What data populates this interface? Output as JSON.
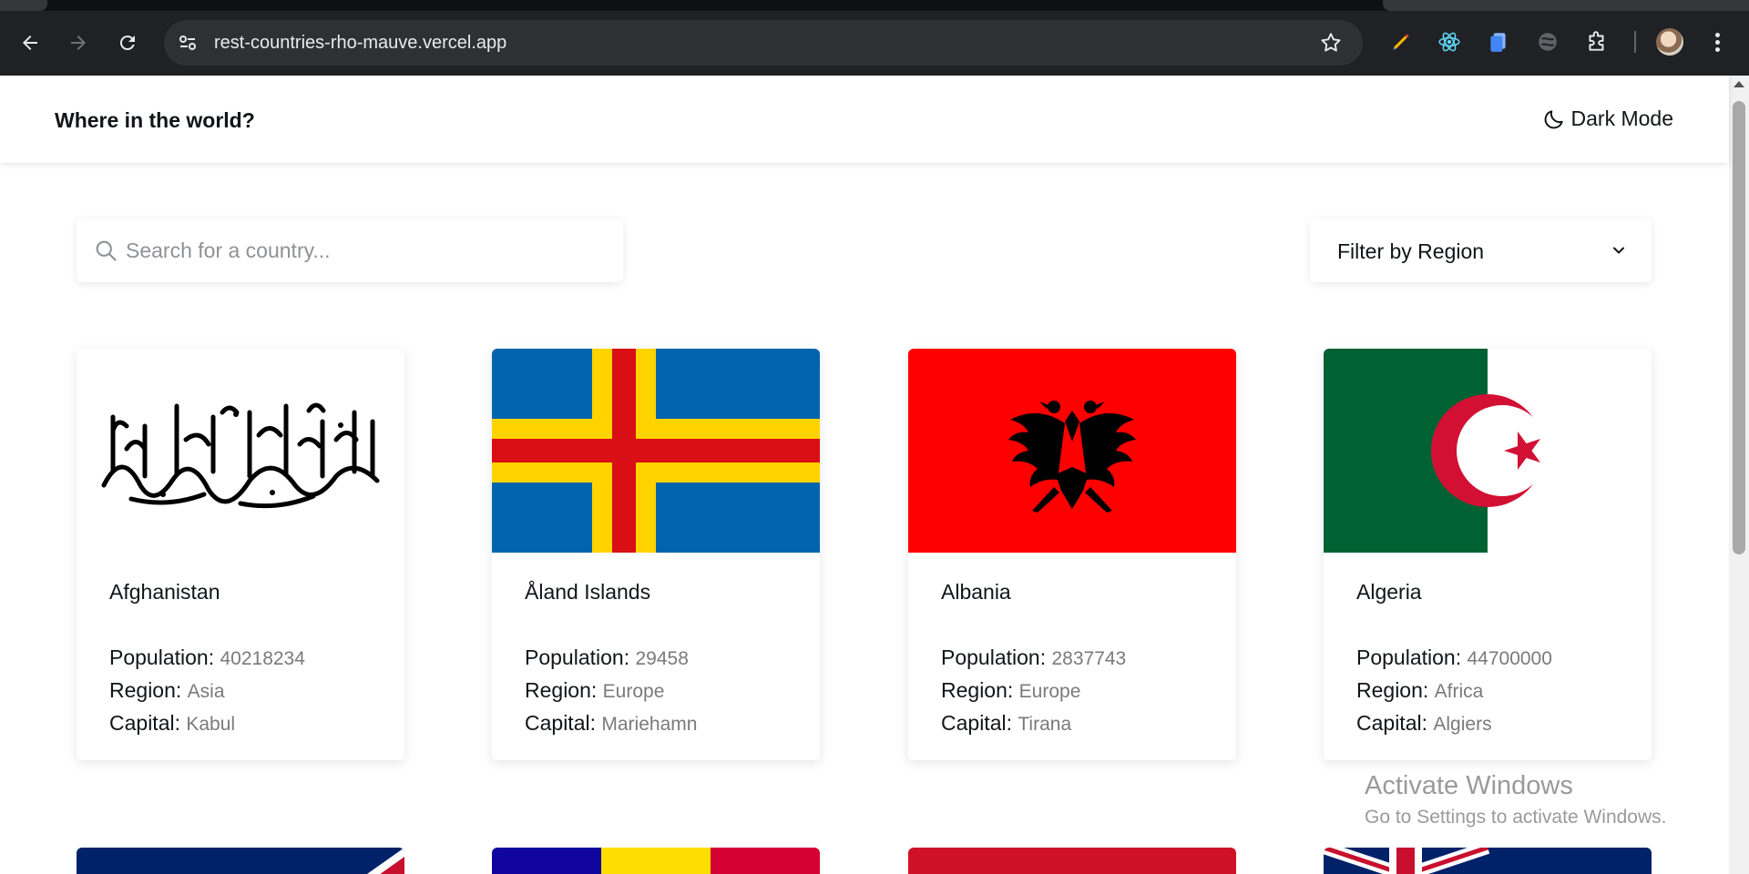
{
  "browser": {
    "url": "rest-countries-rho-mauve.vercel.app",
    "icons": [
      "back-icon",
      "forward-icon",
      "reload-icon",
      "site-info-icon",
      "bookmark-star-icon",
      "pen-extension-icon",
      "react-devtools-icon",
      "docs-extension-icon",
      "vpn-extension-icon",
      "extensions-puzzle-icon",
      "profile-avatar",
      "menu-dots-icon"
    ]
  },
  "header": {
    "title": "Where in the world?",
    "dark_mode_label": "Dark Mode"
  },
  "controls": {
    "search_placeholder": "Search for a country...",
    "filter_label": "Filter by Region"
  },
  "labels": {
    "population": "Population:",
    "region": "Region:",
    "capital": "Capital:"
  },
  "countries": [
    {
      "name": "Afghanistan",
      "population": "40218234",
      "region": "Asia",
      "capital": "Kabul"
    },
    {
      "name": "Åland Islands",
      "population": "29458",
      "region": "Europe",
      "capital": "Mariehamn"
    },
    {
      "name": "Albania",
      "population": "2837743",
      "region": "Europe",
      "capital": "Tirana"
    },
    {
      "name": "Algeria",
      "population": "44700000",
      "region": "Africa",
      "capital": "Algiers"
    }
  ],
  "watermark": {
    "line1": "Activate Windows",
    "line2": "Go to Settings to activate Windows."
  },
  "colors": {
    "text": "#111517",
    "muted_value": "#7a7a7a",
    "chrome_bg": "#202124"
  }
}
